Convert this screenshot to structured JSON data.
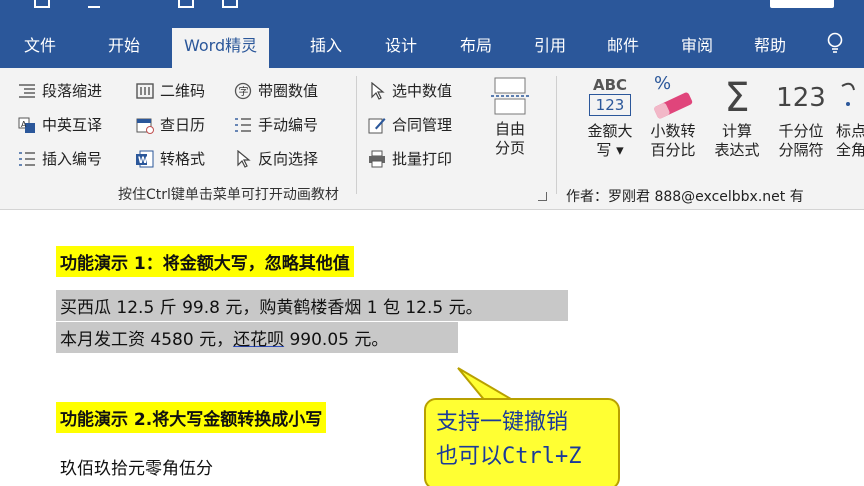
{
  "ribbon_tabs": [
    "文件",
    "开始",
    "Word精灵",
    "插入",
    "设计",
    "布局",
    "引用",
    "邮件",
    "审阅",
    "帮助"
  ],
  "active_tab": "Word精灵",
  "ribbon": {
    "col1": [
      "段落缩进",
      "中英互译",
      "插入编号"
    ],
    "col2": [
      "二维码",
      "查日历",
      "转格式"
    ],
    "col3": [
      "带圈数值",
      "手动编号",
      "反向选择"
    ],
    "col4": [
      "选中数值",
      "合同管理",
      "批量打印"
    ],
    "free_pagination": "自由\n分页",
    "group_hint": "按住Ctrl键单击菜单可打开动画教材",
    "amount_upper": "金额大\n写 ▾",
    "decimal_percent": "小数转\n百分比",
    "calc_expression": "计算\n表达式",
    "thousand_sep": "千分位\n分隔符",
    "punct_fullwidth": "标点\n全角",
    "icon_abc": "ABC",
    "icon_123_box": "123",
    "icon_123": "123",
    "icon_percent": "%",
    "icon_sigma": "Σ",
    "author": "作者：罗刚君 888@excelbbx.net 有"
  },
  "document": {
    "demo1_title": "功能演示 1：将金额大写，忽略其他值",
    "line1": "买西瓜 12.5 斤 99.8 元，购黄鹤楼香烟 1 包 12.5 元。",
    "line2_a": "本月发工资 4580 元，",
    "line2_b": "还花呗",
    "line2_c": " 990.05 元。",
    "demo2_title": "功能演示 2.将大写金额转换成小写",
    "line3": "玖佰玖拾元零角伍分"
  },
  "callout": {
    "line1": "支持一键撤销",
    "line2": "也可以Ctrl+Z"
  }
}
